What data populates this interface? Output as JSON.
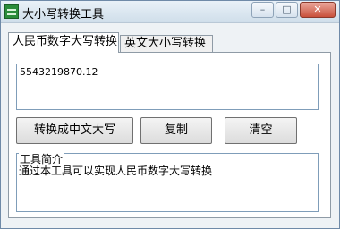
{
  "window": {
    "title": "大小写转换工具",
    "minimize_glyph": "–",
    "maximize_glyph": "□",
    "close_glyph": "✕",
    "close_color": "#c9503b"
  },
  "tabs": [
    {
      "label": "人民币数字大写转换",
      "active": true
    },
    {
      "label": "英文大小写转换",
      "active": false
    }
  ],
  "panel": {
    "input_value": "5543219870.12",
    "buttons": {
      "convert": "转换成中文大写",
      "copy": "复制",
      "clear": "清空"
    },
    "intro": {
      "legend": "工具简介",
      "text": "通过本工具可以实现人民币数字大写转换"
    }
  }
}
